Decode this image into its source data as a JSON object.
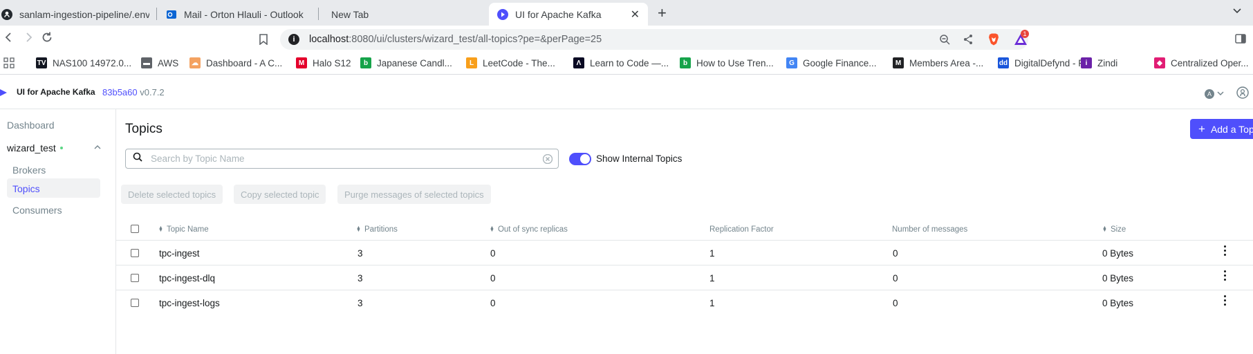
{
  "browser": {
    "tabs": [
      {
        "title": "sanlam-ingestion-pipeline/.env",
        "icon": "github-icon"
      },
      {
        "title": "Mail - Orton Hlauli - Outlook",
        "icon": "outlook-icon"
      },
      {
        "title": "New Tab",
        "icon": ""
      },
      {
        "title": "UI for Apache Kafka",
        "icon": "kafka-ui-icon",
        "active": true
      }
    ],
    "url_host": "localhost",
    "url_rest": ":8080/ui/clusters/wizard_test/all-topics?pe=&perPage=25",
    "extension_badge": "1",
    "bookmarks": [
      {
        "label": "NAS100 14972.0...",
        "icon": "tradingview-icon",
        "color": "#131722"
      },
      {
        "label": "AWS",
        "icon": "folder-icon",
        "color": "#5f6368"
      },
      {
        "label": "Dashboard - A C...",
        "icon": "cloud-icon",
        "color": "#f4a261"
      },
      {
        "label": "Halo S12",
        "icon": "halo-icon",
        "color": "#e4002b"
      },
      {
        "label": "Japanese Candl...",
        "icon": "b-icon",
        "color": "#16a34a"
      },
      {
        "label": "LeetCode - The...",
        "icon": "leetcode-icon",
        "color": "#f89f1b"
      },
      {
        "label": "Learn to Code —...",
        "icon": "fcc-icon",
        "color": "#0a0a23"
      },
      {
        "label": "How to Use Tren...",
        "icon": "b-icon",
        "color": "#16a34a"
      },
      {
        "label": "Google Finance...",
        "icon": "google-finance-icon",
        "color": "#4285f4"
      },
      {
        "label": "Members Area -...",
        "icon": "members-icon",
        "color": "#202124"
      },
      {
        "label": "DigitalDefynd - F...",
        "icon": "dd-icon",
        "color": "#1a56db"
      },
      {
        "label": "Zindi",
        "icon": "zindi-icon",
        "color": "#6b21a8"
      },
      {
        "label": "Centralized Oper...",
        "icon": "box-icon",
        "color": "#e11d74"
      }
    ]
  },
  "app": {
    "name": "UI for Apache Kafka",
    "commit": "83b5a60",
    "version": "v0.7.2",
    "user_initial": "A"
  },
  "sidebar": {
    "dashboard": "Dashboard",
    "cluster": "wizard_test",
    "items": [
      "Brokers",
      "Topics",
      "Consumers"
    ],
    "active": "Topics"
  },
  "page": {
    "title": "Topics",
    "add_button": "Add a Topic",
    "search_placeholder": "Search by Topic Name",
    "toggle_label": "Show Internal Topics",
    "toggle_on": true,
    "bulk_actions": [
      "Delete selected topics",
      "Copy selected topic",
      "Purge messages of selected topics"
    ]
  },
  "table": {
    "columns": [
      "Topic Name",
      "Partitions",
      "Out of sync replicas",
      "Replication Factor",
      "Number of messages",
      "Size"
    ],
    "rows": [
      {
        "name": "tpc-ingest",
        "partitions": "3",
        "out_of_sync": "0",
        "replication": "1",
        "messages": "0",
        "size": "0 Bytes"
      },
      {
        "name": "tpc-ingest-dlq",
        "partitions": "3",
        "out_of_sync": "0",
        "replication": "1",
        "messages": "0",
        "size": "0 Bytes"
      },
      {
        "name": "tpc-ingest-logs",
        "partitions": "3",
        "out_of_sync": "0",
        "replication": "1",
        "messages": "0",
        "size": "0 Bytes"
      }
    ]
  },
  "colors": {
    "accent": "#4f4ffc",
    "online": "#5cd685"
  }
}
